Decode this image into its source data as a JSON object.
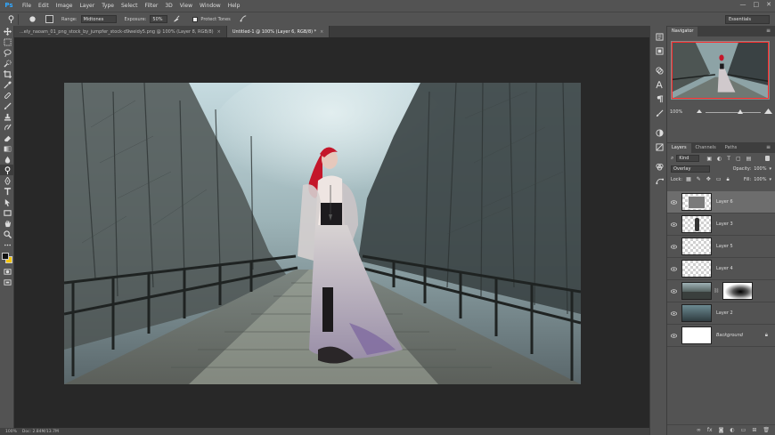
{
  "app": {
    "logo": "Ps",
    "menu": [
      "File",
      "Edit",
      "Image",
      "Layer",
      "Type",
      "Select",
      "Filter",
      "3D",
      "View",
      "Window",
      "Help"
    ],
    "window_controls": [
      "—",
      "□",
      "✕"
    ]
  },
  "options_bar": {
    "range_label": "Range:",
    "range_value": "Midtones",
    "exposure_label": "Exposure:",
    "exposure_value": "50%",
    "protect_tones_label": "Protect Tones",
    "workspace": "Essentials"
  },
  "tabs": [
    {
      "label": "...ely_naoam_01_png_stock_by_jumpfer_stock-d9weidy5.png @ 100% (Layer 8, RGB/8)",
      "close": "×",
      "active": false
    },
    {
      "label": "Untitled-1 @ 100% (Layer 6, RGB/8) *",
      "close": "×",
      "active": true
    }
  ],
  "status_bar": {
    "zoom": "100%",
    "doc_size": "Doc: 2.84M/13.7M"
  },
  "navigator": {
    "tab_label": "Navigator",
    "zoom_value": "100%",
    "menu_icon": "≡"
  },
  "layers_panel": {
    "tabs": [
      "Layers",
      "Channels",
      "Paths"
    ],
    "filter_kind": "Kind",
    "blend_mode": "Overlay",
    "opacity_label": "Opacity:",
    "opacity_value": "100%",
    "lock_label": "Lock:",
    "fill_label": "Fill:",
    "fill_value": "100%",
    "layers": [
      {
        "name": "Layer 6",
        "thumb": "gray",
        "selected": true,
        "italic": false,
        "mask": false,
        "locked": false
      },
      {
        "name": "Layer 3",
        "thumb": "checker-figure",
        "selected": false,
        "italic": false,
        "mask": false,
        "locked": false
      },
      {
        "name": "Layer 5",
        "thumb": "checker",
        "selected": false,
        "italic": false,
        "mask": false,
        "locked": false
      },
      {
        "name": "Layer 4",
        "thumb": "checker",
        "selected": false,
        "italic": false,
        "mask": false,
        "locked": false
      },
      {
        "name": "",
        "thumb": "photo",
        "selected": false,
        "italic": false,
        "mask": true,
        "locked": false
      },
      {
        "name": "Layer 2",
        "thumb": "photo-dark",
        "selected": false,
        "italic": false,
        "mask": false,
        "locked": false
      },
      {
        "name": "Background",
        "thumb": "white",
        "selected": false,
        "italic": true,
        "mask": false,
        "locked": true
      }
    ],
    "footer_icons": [
      "link-icon",
      "fx-icon",
      "mask-icon",
      "adjustment-icon",
      "group-icon",
      "new-layer-icon",
      "trash-icon"
    ]
  },
  "colors": {
    "accent_proxy": "#ff2c2c",
    "panel_bg": "#535353",
    "canvas_bg": "#282828",
    "selected_layer": "#6d6d6d",
    "foreground_color": "#111111",
    "background_color": "#f4c400"
  }
}
